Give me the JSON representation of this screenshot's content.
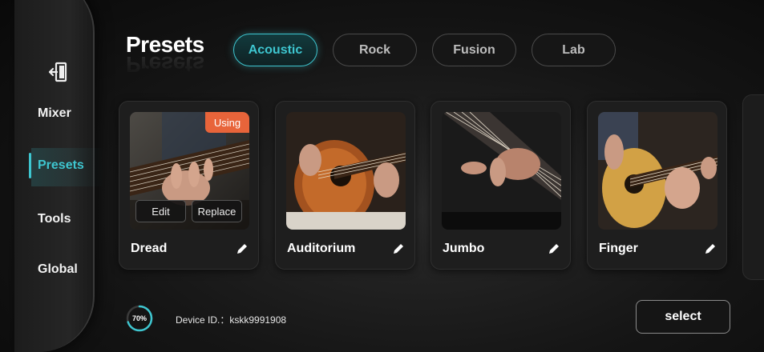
{
  "sidebar": {
    "exit_icon": "exit-door-icon",
    "items": [
      {
        "label": "Mixer",
        "active": false
      },
      {
        "label": "Presets",
        "active": true
      },
      {
        "label": "Tools",
        "active": false
      },
      {
        "label": "Global",
        "active": false
      }
    ]
  },
  "header": {
    "title": "Presets",
    "tabs": [
      {
        "label": "Acoustic",
        "active": true
      },
      {
        "label": "Rock",
        "active": false
      },
      {
        "label": "Fusion",
        "active": false
      },
      {
        "label": "Lab",
        "active": false
      }
    ]
  },
  "cards": [
    {
      "name": "Dread",
      "badge": "Using",
      "edit_label": "Edit",
      "replace_label": "Replace",
      "image": "guitar-fretting-photo"
    },
    {
      "name": "Auditorium",
      "image": "guitar-strumming-photo"
    },
    {
      "name": "Jumbo",
      "image": "guitar-neck-closeup-photo"
    },
    {
      "name": "Finger",
      "image": "fingerstyle-guitar-photo"
    }
  ],
  "footer": {
    "progress_percent": 70,
    "progress_label": "70%",
    "device_id_label": "Device ID.：kskk9991908",
    "select_label": "select"
  },
  "colors": {
    "accent": "#3ec6d0",
    "badge": "#e8643a",
    "background": "#0d0d0d"
  }
}
